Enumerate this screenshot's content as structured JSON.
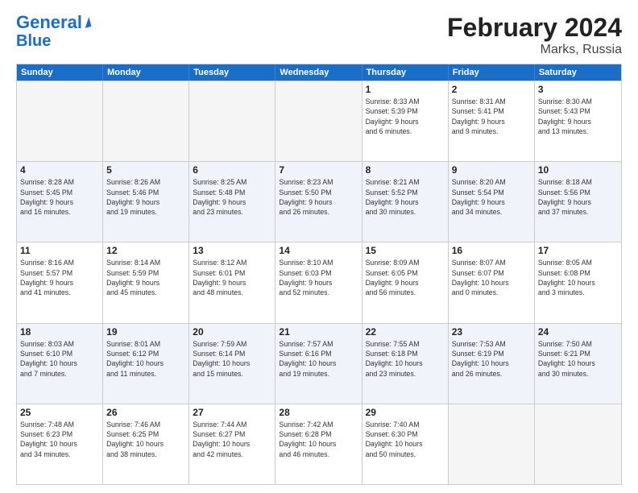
{
  "header": {
    "logo_line1": "General",
    "logo_line2": "Blue",
    "title": "February 2024",
    "subtitle": "Marks, Russia"
  },
  "calendar": {
    "days": [
      "Sunday",
      "Monday",
      "Tuesday",
      "Wednesday",
      "Thursday",
      "Friday",
      "Saturday"
    ],
    "rows": [
      [
        {
          "day": "",
          "info": ""
        },
        {
          "day": "",
          "info": ""
        },
        {
          "day": "",
          "info": ""
        },
        {
          "day": "",
          "info": ""
        },
        {
          "day": "1",
          "info": "Sunrise: 8:33 AM\nSunset: 5:39 PM\nDaylight: 9 hours\nand 6 minutes."
        },
        {
          "day": "2",
          "info": "Sunrise: 8:31 AM\nSunset: 5:41 PM\nDaylight: 9 hours\nand 9 minutes."
        },
        {
          "day": "3",
          "info": "Sunrise: 8:30 AM\nSunset: 5:43 PM\nDaylight: 9 hours\nand 13 minutes."
        }
      ],
      [
        {
          "day": "4",
          "info": "Sunrise: 8:28 AM\nSunset: 5:45 PM\nDaylight: 9 hours\nand 16 minutes."
        },
        {
          "day": "5",
          "info": "Sunrise: 8:26 AM\nSunset: 5:46 PM\nDaylight: 9 hours\nand 19 minutes."
        },
        {
          "day": "6",
          "info": "Sunrise: 8:25 AM\nSunset: 5:48 PM\nDaylight: 9 hours\nand 23 minutes."
        },
        {
          "day": "7",
          "info": "Sunrise: 8:23 AM\nSunset: 5:50 PM\nDaylight: 9 hours\nand 26 minutes."
        },
        {
          "day": "8",
          "info": "Sunrise: 8:21 AM\nSunset: 5:52 PM\nDaylight: 9 hours\nand 30 minutes."
        },
        {
          "day": "9",
          "info": "Sunrise: 8:20 AM\nSunset: 5:54 PM\nDaylight: 9 hours\nand 34 minutes."
        },
        {
          "day": "10",
          "info": "Sunrise: 8:18 AM\nSunset: 5:56 PM\nDaylight: 9 hours\nand 37 minutes."
        }
      ],
      [
        {
          "day": "11",
          "info": "Sunrise: 8:16 AM\nSunset: 5:57 PM\nDaylight: 9 hours\nand 41 minutes."
        },
        {
          "day": "12",
          "info": "Sunrise: 8:14 AM\nSunset: 5:59 PM\nDaylight: 9 hours\nand 45 minutes."
        },
        {
          "day": "13",
          "info": "Sunrise: 8:12 AM\nSunset: 6:01 PM\nDaylight: 9 hours\nand 48 minutes."
        },
        {
          "day": "14",
          "info": "Sunrise: 8:10 AM\nSunset: 6:03 PM\nDaylight: 9 hours\nand 52 minutes."
        },
        {
          "day": "15",
          "info": "Sunrise: 8:09 AM\nSunset: 6:05 PM\nDaylight: 9 hours\nand 56 minutes."
        },
        {
          "day": "16",
          "info": "Sunrise: 8:07 AM\nSunset: 6:07 PM\nDaylight: 10 hours\nand 0 minutes."
        },
        {
          "day": "17",
          "info": "Sunrise: 8:05 AM\nSunset: 6:08 PM\nDaylight: 10 hours\nand 3 minutes."
        }
      ],
      [
        {
          "day": "18",
          "info": "Sunrise: 8:03 AM\nSunset: 6:10 PM\nDaylight: 10 hours\nand 7 minutes."
        },
        {
          "day": "19",
          "info": "Sunrise: 8:01 AM\nSunset: 6:12 PM\nDaylight: 10 hours\nand 11 minutes."
        },
        {
          "day": "20",
          "info": "Sunrise: 7:59 AM\nSunset: 6:14 PM\nDaylight: 10 hours\nand 15 minutes."
        },
        {
          "day": "21",
          "info": "Sunrise: 7:57 AM\nSunset: 6:16 PM\nDaylight: 10 hours\nand 19 minutes."
        },
        {
          "day": "22",
          "info": "Sunrise: 7:55 AM\nSunset: 6:18 PM\nDaylight: 10 hours\nand 23 minutes."
        },
        {
          "day": "23",
          "info": "Sunrise: 7:53 AM\nSunset: 6:19 PM\nDaylight: 10 hours\nand 26 minutes."
        },
        {
          "day": "24",
          "info": "Sunrise: 7:50 AM\nSunset: 6:21 PM\nDaylight: 10 hours\nand 30 minutes."
        }
      ],
      [
        {
          "day": "25",
          "info": "Sunrise: 7:48 AM\nSunset: 6:23 PM\nDaylight: 10 hours\nand 34 minutes."
        },
        {
          "day": "26",
          "info": "Sunrise: 7:46 AM\nSunset: 6:25 PM\nDaylight: 10 hours\nand 38 minutes."
        },
        {
          "day": "27",
          "info": "Sunrise: 7:44 AM\nSunset: 6:27 PM\nDaylight: 10 hours\nand 42 minutes."
        },
        {
          "day": "28",
          "info": "Sunrise: 7:42 AM\nSunset: 6:28 PM\nDaylight: 10 hours\nand 46 minutes."
        },
        {
          "day": "29",
          "info": "Sunrise: 7:40 AM\nSunset: 6:30 PM\nDaylight: 10 hours\nand 50 minutes."
        },
        {
          "day": "",
          "info": ""
        },
        {
          "day": "",
          "info": ""
        }
      ]
    ]
  }
}
